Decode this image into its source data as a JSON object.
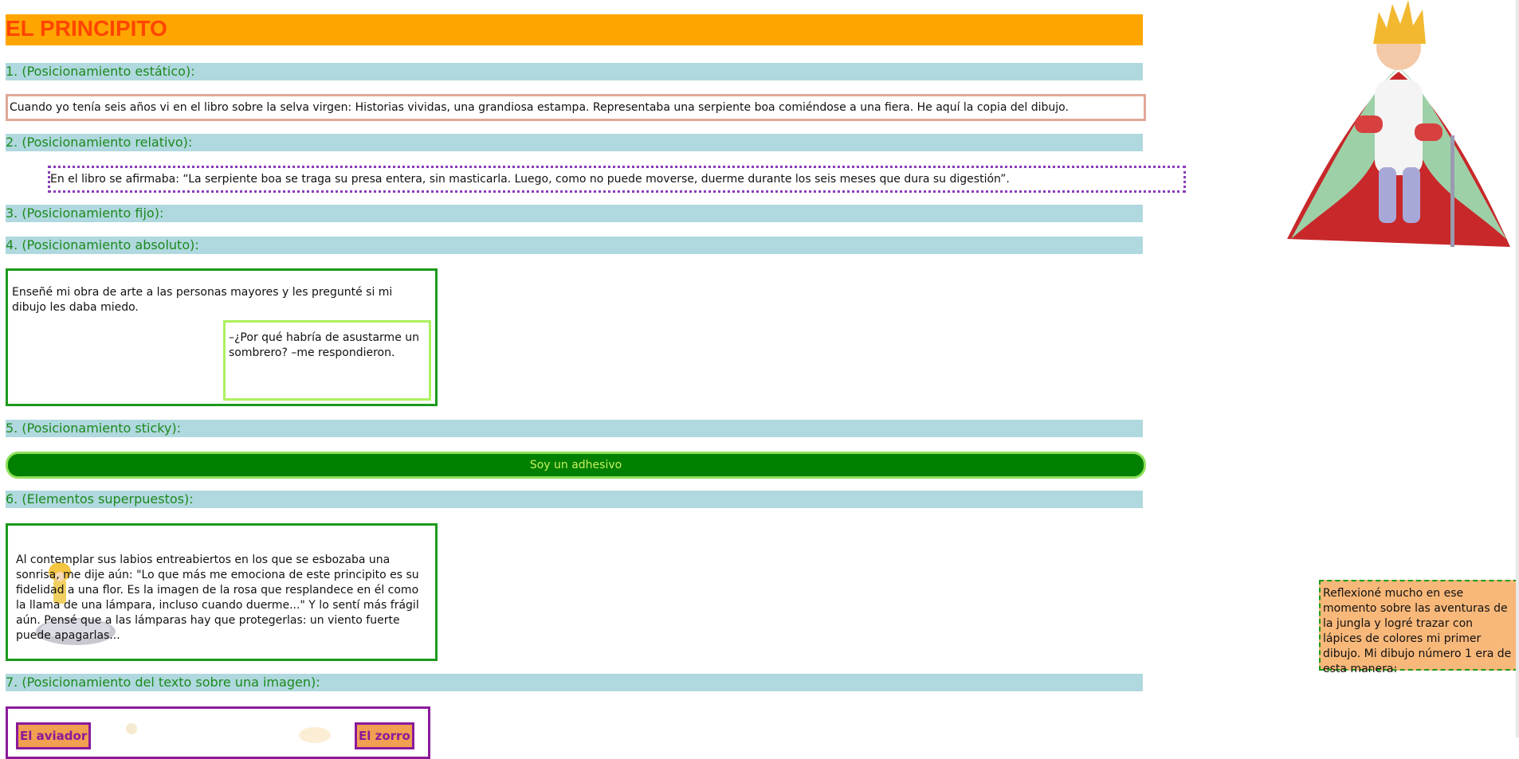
{
  "title": "EL PRINCIPITO",
  "sections": {
    "s1": "1. (Posicionamiento estático):",
    "s2": "2. (Posicionamiento relativo):",
    "s3": "3. (Posicionamiento fijo):",
    "s4": "4. (Posicionamiento absoluto):",
    "s5": "5. (Posicionamiento sticky):",
    "s6": "6. (Elementos superpuestos):",
    "s7": "7. (Posicionamiento del texto sobre una imagen):"
  },
  "static_text": "Cuando yo tenía seis años vi en el libro sobre la selva virgen: Historias vividas, una grandiosa estampa. Representaba una serpiente boa comiéndose a una fiera. He aquí la copia del dibujo.",
  "relative_text": "En el libro se afirmaba: “La serpiente boa se traga su presa entera, sin masticarla. Luego, como no puede moverse, duerme durante los seis meses que dura su digestión”.",
  "absolute": {
    "outer_text": "Enseñé mi obra de arte a las personas mayores y les pregunté si mi dibujo les daba miedo.",
    "inner_text": "–¿Por qué habría de asustarme un sombrero? –me respondieron."
  },
  "sticky_text": "Soy un adhesivo",
  "overlap_text": "Al contemplar sus labios entreabiertos en los que se esbozaba una sonrisa, me dije aún: \"Lo que más me emociona de este principito es su fidelidad a una flor. Es la imagen de la rosa que resplandece en él como la llama de una lámpara, incluso cuando duerme...\" Y lo sentí más frágil aún. Pensé que a las lámparas hay que protegerlas: un viento fuerte puede apagarlas...",
  "image_labels": {
    "left": "El aviador",
    "right": "El zorro"
  },
  "fixed_note": "Reflexioné mucho en ese momento sobre las aventuras de la jungla y logré trazar con lápices de colores mi primer dibujo. Mi dibujo número 1 era de esta manera:",
  "colors": {
    "title_bg": "#ffa500",
    "title_text": "#ff4500",
    "section_bg": "#b0d8df",
    "section_text": "#1c8a1c",
    "sticky_bg": "#008000",
    "note_bg": "#f8b87a"
  }
}
